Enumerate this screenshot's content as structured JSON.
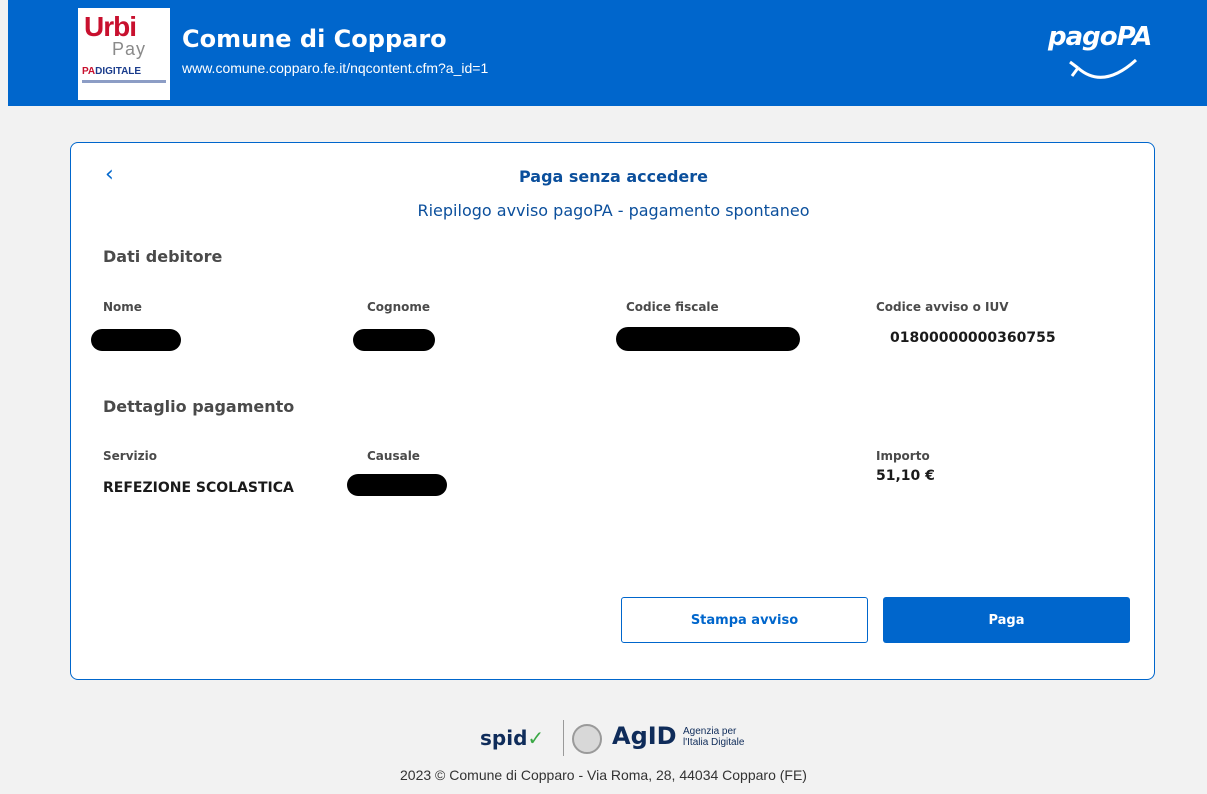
{
  "header": {
    "logo_main": "Urbi",
    "logo_sub": "Pay",
    "logo_padigitale_pa": "PA",
    "logo_padigitale_rest": "DIGITALE",
    "title": "Comune di Copparo",
    "url": "www.comune.copparo.fe.it/nqcontent.cfm?a_id=1",
    "brand_logo": "pagoPA",
    "brand_color": "#0066cc"
  },
  "card": {
    "title": "Paga senza accedere",
    "subtitle": "Riepilogo avviso pagoPA - pagamento spontaneo",
    "debtor_section": {
      "title": "Dati debitore",
      "fields": [
        {
          "label": "Nome",
          "value": ""
        },
        {
          "label": "Cognome",
          "value": ""
        },
        {
          "label": "Codice fiscale",
          "value": ""
        },
        {
          "label": "Codice avviso o IUV",
          "value": "01800000000360755"
        }
      ]
    },
    "payment_section": {
      "title": "Dettaglio pagamento",
      "fields": [
        {
          "label": "Servizio",
          "value": "REFEZIONE SCOLASTICA"
        },
        {
          "label": "Causale",
          "value": ""
        },
        {
          "label": "Importo",
          "value": "51,10 €"
        }
      ]
    },
    "buttons": {
      "print_label": "Stampa avviso",
      "pay_label": "Paga"
    }
  },
  "footer": {
    "spid_label": "spid",
    "agid_label": "AgID",
    "agid_sub": "Agenzia per l'Italia Digitale",
    "copyright": "2023 © Comune di Copparo - Via Roma, 28, 44034 Copparo (FE)"
  }
}
